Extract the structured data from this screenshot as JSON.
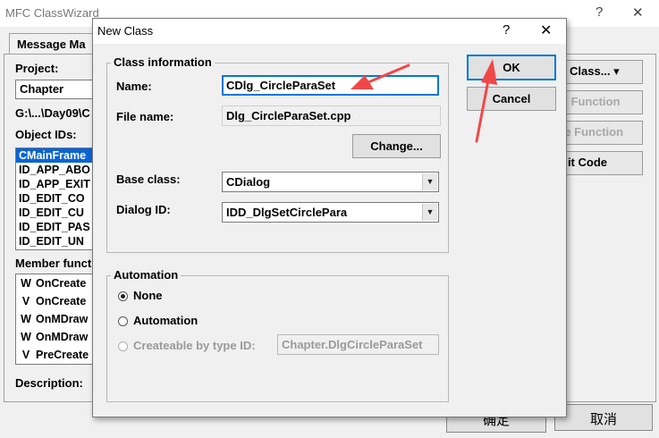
{
  "background_window": {
    "title": "MFC ClassWizard",
    "help_glyph": "?",
    "close_glyph": "✕",
    "tab_label": "Message Ma",
    "project_label": "Project:",
    "project_value": "Chapter",
    "path_text": "G:\\...\\Day09\\C",
    "object_ids_label": "Object IDs:",
    "object_ids": [
      "CMainFrame",
      "ID_APP_ABO",
      "ID_APP_EXIT",
      "ID_EDIT_CO",
      "ID_EDIT_CU",
      "ID_EDIT_PAS",
      "ID_EDIT_UN"
    ],
    "member_functions_label": "Member funct",
    "member_functions": [
      {
        "type": "W",
        "name": "OnCreate"
      },
      {
        "type": "V",
        "name": "OnCreate"
      },
      {
        "type": "W",
        "name": "OnMDraw"
      },
      {
        "type": "W",
        "name": "OnMDraw"
      },
      {
        "type": "V",
        "name": "PreCreate"
      }
    ],
    "description_label": "Description:",
    "right_buttons": [
      "Class... ▾",
      "d Function",
      "te Function",
      "dit Code"
    ],
    "ok_partial": "确定",
    "cancel_label": "取消"
  },
  "dialog": {
    "title": "New Class",
    "help_glyph": "?",
    "close_glyph": "✕",
    "class_info_caption": "Class information",
    "name_label": "Name:",
    "name_value": "CDlg_CircleParaSet",
    "filename_label": "File name:",
    "filename_value": "Dlg_CircleParaSet.cpp",
    "change_button": "Change...",
    "base_class_label": "Base class:",
    "base_class_value": "CDialog",
    "dialog_id_label": "Dialog ID:",
    "dialog_id_value": "IDD_DlgSetCirclePara",
    "automation_caption": "Automation",
    "radio_none": "None",
    "radio_automation": "Automation",
    "radio_createable": "Createable by type ID:",
    "createable_value": "Chapter.DlgCircleParaSet",
    "ok_button": "OK",
    "cancel_button": "Cancel"
  },
  "colors": {
    "annotation_arrow": "#f04848",
    "selection": "#0a64d6",
    "focus_border": "#0078d7"
  }
}
